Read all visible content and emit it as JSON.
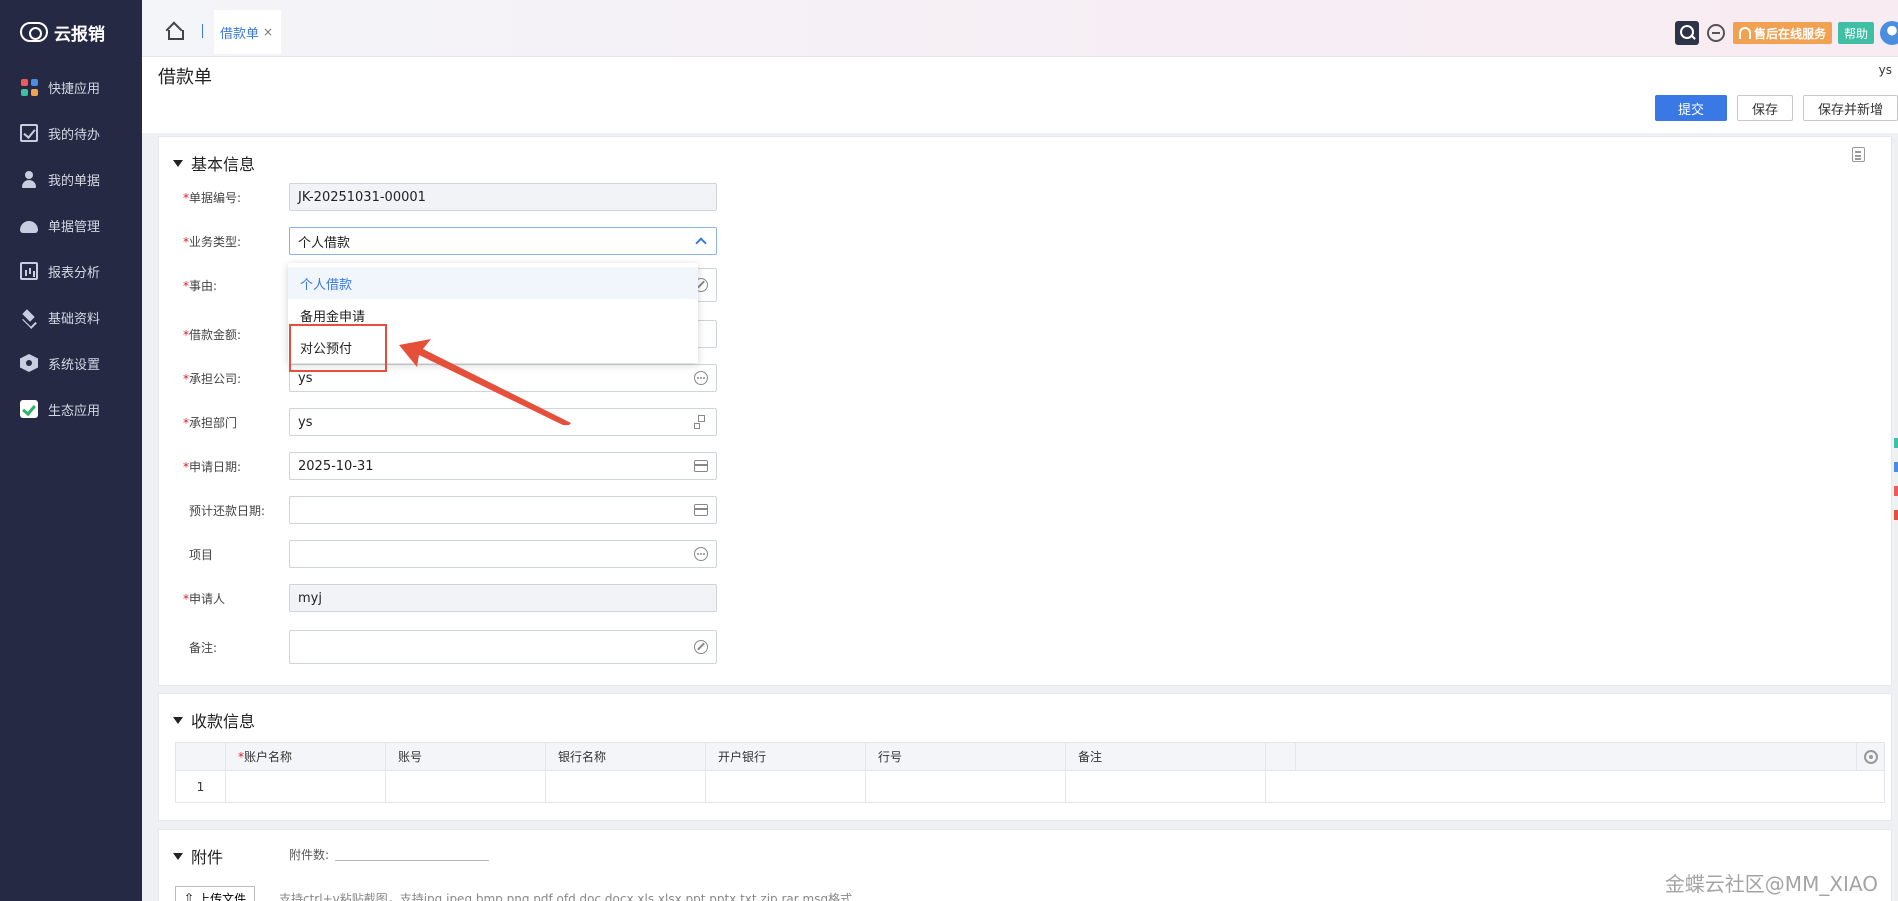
{
  "app": {
    "logo_text": "云报销"
  },
  "sidebar": {
    "items": [
      {
        "label": "快捷应用",
        "icon": "apps-icon"
      },
      {
        "label": "我的待办",
        "icon": "todo-icon"
      },
      {
        "label": "我的单据",
        "icon": "user-icon"
      },
      {
        "label": "单据管理",
        "icon": "document-icon"
      },
      {
        "label": "报表分析",
        "icon": "chart-icon"
      },
      {
        "label": "基础资料",
        "icon": "layers-icon"
      },
      {
        "label": "系统设置",
        "icon": "settings-icon"
      },
      {
        "label": "生态应用",
        "icon": "eco-icon"
      }
    ],
    "apps_colors": [
      "#f05a5a",
      "#4a8ee0",
      "#3fbfa4",
      "#f0a252"
    ]
  },
  "topbar": {
    "tab_label": "借款单",
    "tab_close": "×",
    "service_label": "售后在线服务",
    "help_label": "帮助"
  },
  "page": {
    "title": "借款单",
    "user": "ys",
    "submit_label": "提交",
    "save_label": "保存",
    "save_new_label": "保存并新增"
  },
  "basic": {
    "title": "基本信息",
    "fields": {
      "doc_no": {
        "label": "单据编号:",
        "value": "JK-20251031-00001"
      },
      "biz_type": {
        "label": "业务类型:",
        "value": "个人借款"
      },
      "reason": {
        "label": "事由:",
        "value": ""
      },
      "amount": {
        "label": "借款金额:",
        "value": ""
      },
      "company": {
        "label": "承担公司:",
        "value": "ys"
      },
      "dept": {
        "label": "承担部门",
        "value": "ys"
      },
      "apply_date": {
        "label": "申请日期:",
        "value": "2025-10-31"
      },
      "repay_date": {
        "label": "预计还款日期:",
        "value": ""
      },
      "project": {
        "label": "项目",
        "value": ""
      },
      "applicant": {
        "label": "申请人",
        "value": "myj"
      },
      "remark": {
        "label": "备注:",
        "value": ""
      }
    },
    "required_mark": "*",
    "dropdown_options": [
      "个人借款",
      "备用金申请",
      "对公预付"
    ]
  },
  "payee": {
    "title": "收款信息",
    "columns": [
      "账户名称",
      "账号",
      "银行名称",
      "开户银行",
      "行号",
      "备注"
    ],
    "rows": [
      [
        "1"
      ]
    ]
  },
  "attach": {
    "title": "附件",
    "count_label": "附件数:",
    "upload_label": "上传文件",
    "upload_hint": "支持ctrl+v粘贴截图，支持jpg,jpeg,bmp,png,pdf,ofd,doc,docx,xls,xlsx,ppt,pptx,txt,zip,rar,msg格式"
  },
  "watermark": "金蝶云社区@MM_XIAO",
  "colors": {
    "primary": "#3a78e6",
    "sidebar_bg": "#252944",
    "annotation": "#e5503b"
  }
}
